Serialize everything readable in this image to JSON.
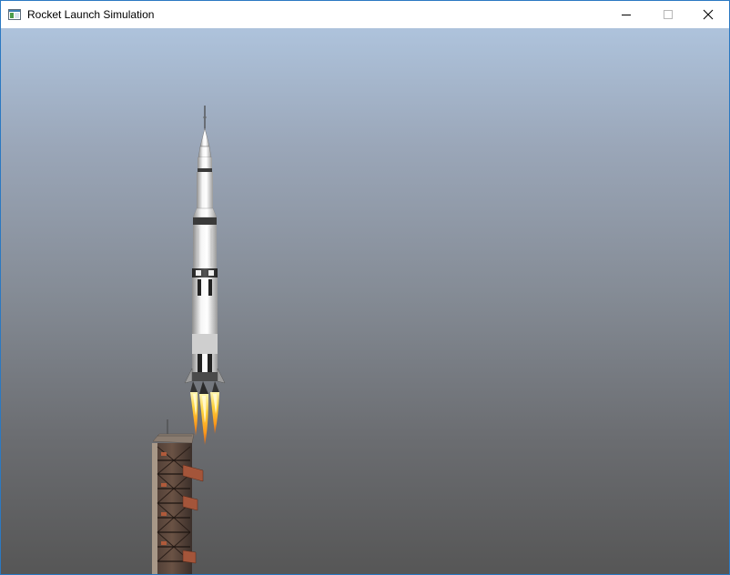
{
  "window": {
    "title": "Rocket Launch Simulation",
    "border_color": "#2b79c2"
  },
  "titlebar": {
    "app_icon": "application-window-icon",
    "minimize_icon": "minimize-icon",
    "maximize_icon": "maximize-icon",
    "close_icon": "close-icon"
  },
  "scene": {
    "sky_top_color": "#aec3dc",
    "sky_bottom_color": "#565656",
    "objects": [
      "rocket",
      "engine-flames",
      "launch-tower"
    ]
  }
}
